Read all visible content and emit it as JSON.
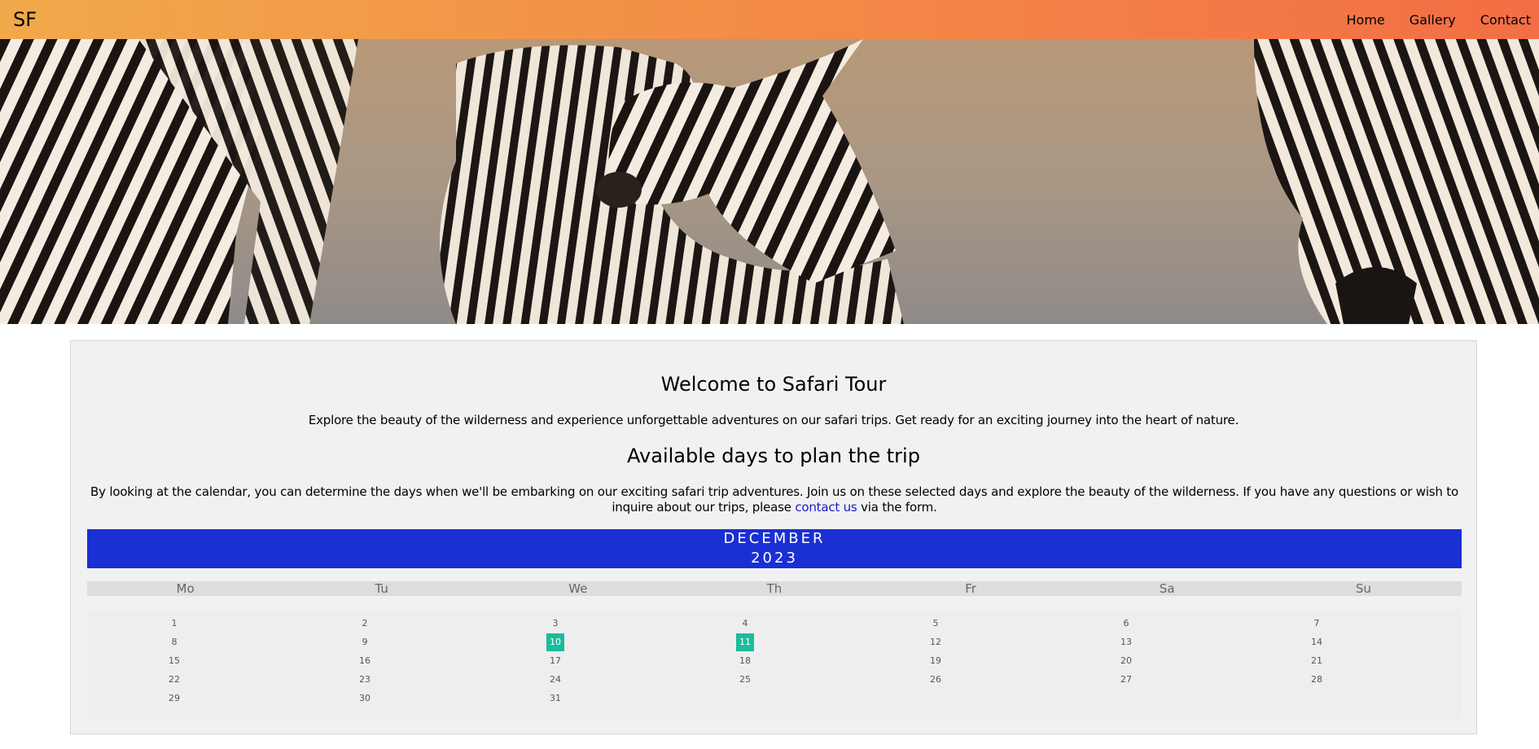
{
  "header": {
    "logo": "SF",
    "nav": [
      {
        "label": "Home"
      },
      {
        "label": "Gallery"
      },
      {
        "label": "Contact"
      }
    ]
  },
  "colors": {
    "accent": "#1a2fd4",
    "active_day": "#1abc9c",
    "link": "#1a1acb"
  },
  "hero": {
    "image": "zebras-photo"
  },
  "intro": {
    "title": "Welcome to Safari Tour",
    "text": "Explore the beauty of the wilderness and experience unforgettable adventures on our safari trips. Get ready for an exciting journey into the heart of nature."
  },
  "plan": {
    "title": "Available days to plan the trip",
    "text_before": "By looking at the calendar, you can determine the days when we'll be embarking on our exciting safari trip adventures. Join us on these selected days and explore the beauty of the wilderness. If you have any questions or wish to inquire about our trips, please ",
    "link": "contact us",
    "text_after": " via the form."
  },
  "calendar": {
    "month": "DECEMBER",
    "year": "2023",
    "weekdays": [
      "Mo",
      "Tu",
      "We",
      "Th",
      "Fr",
      "Sa",
      "Su"
    ],
    "days": [
      [
        "1",
        "2",
        "3",
        "4",
        "5",
        "6",
        "7"
      ],
      [
        "8",
        "9",
        "10",
        "11",
        "12",
        "13",
        "14"
      ],
      [
        "15",
        "16",
        "17",
        "18",
        "19",
        "20",
        "21"
      ],
      [
        "22",
        "23",
        "24",
        "25",
        "26",
        "27",
        "28"
      ],
      [
        "29",
        "30",
        "31"
      ]
    ],
    "active_days": [
      "10",
      "11"
    ]
  }
}
